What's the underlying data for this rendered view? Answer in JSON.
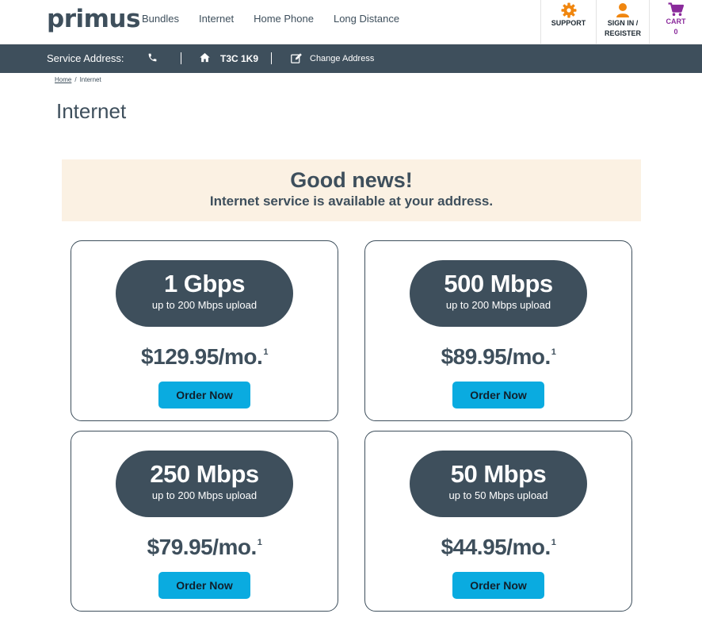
{
  "header": {
    "logo": "primus",
    "nav": [
      "Bundles",
      "Internet",
      "Home Phone",
      "Long Distance"
    ],
    "support_label": "SUPPORT",
    "sign_in_label_1": "SIGN IN /",
    "sign_in_label_2": "REGISTER",
    "cart_label": "CART",
    "cart_count": "0"
  },
  "service_bar": {
    "label": "Service Address:",
    "postal_code": "T3C 1K9",
    "change_label": "Change Address"
  },
  "breadcrumb": {
    "home": "Home",
    "separator": "/",
    "current": "Internet"
  },
  "page": {
    "title": "Internet"
  },
  "banner": {
    "heading": "Good news!",
    "subheading": "Internet service is available at your address."
  },
  "plans": [
    {
      "speed": "1 Gbps",
      "upload": "up to 200 Mbps upload",
      "price": "$129.95/mo.",
      "footnote": "1",
      "button": "Order Now"
    },
    {
      "speed": "500 Mbps",
      "upload": "up to 200 Mbps upload",
      "price": "$89.95/mo.",
      "footnote": "1",
      "button": "Order Now"
    },
    {
      "speed": "250 Mbps",
      "upload": "up to 200 Mbps upload",
      "price": "$79.95/mo.",
      "footnote": "1",
      "button": "Order Now"
    },
    {
      "speed": "50 Mbps",
      "upload": "up to 50 Mbps upload",
      "price": "$44.95/mo.",
      "footnote": "1",
      "button": "Order Now"
    }
  ],
  "colors": {
    "brand_slate": "#3e4f5c",
    "accent_blue": "#0aabe0",
    "support_orange": "#f0860f",
    "cart_purple": "#8a2a9b",
    "banner_bg": "#fbf1e3"
  },
  "icons": [
    "gear-icon",
    "user-icon",
    "cart-icon",
    "phone-icon",
    "home-icon",
    "edit-icon"
  ]
}
